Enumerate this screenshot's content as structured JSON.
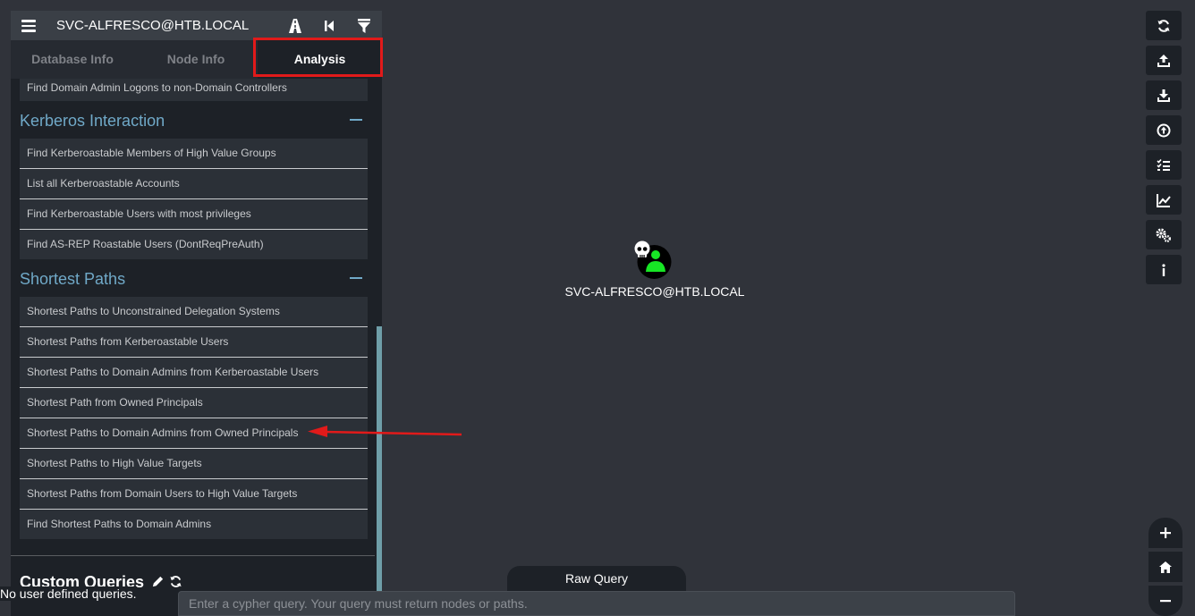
{
  "header": {
    "node_title": "SVC-ALFRESCO@HTB.LOCAL"
  },
  "tabs": [
    {
      "label": "Database Info"
    },
    {
      "label": "Node Info"
    },
    {
      "label": "Analysis"
    }
  ],
  "partial_query": "Find Domain Admin Logons to non-Domain Controllers",
  "sections": [
    {
      "title": "Kerberos Interaction",
      "queries": [
        "Find Kerberoastable Members of High Value Groups",
        "List all Kerberoastable Accounts",
        "Find Kerberoastable Users with most privileges",
        "Find AS-REP Roastable Users (DontReqPreAuth)"
      ]
    },
    {
      "title": "Shortest Paths",
      "queries": [
        "Shortest Paths to Unconstrained Delegation Systems",
        "Shortest Paths from Kerberoastable Users",
        "Shortest Paths to Domain Admins from Kerberoastable Users",
        "Shortest Path from Owned Principals",
        "Shortest Paths to Domain Admins from Owned Principals",
        "Shortest Paths to High Value Targets",
        "Shortest Paths from Domain Users to High Value Targets",
        "Find Shortest Paths to Domain Admins"
      ]
    }
  ],
  "custom_queries": {
    "title": "Custom Queries",
    "empty_text": "No user defined queries."
  },
  "graph_node": {
    "label": "SVC-ALFRESCO@HTB.LOCAL",
    "owned": true
  },
  "toolbar": [
    "refresh-icon",
    "export-icon",
    "import-icon",
    "upload-icon",
    "queries-list-icon",
    "chart-icon",
    "settings-icon",
    "info-icon"
  ],
  "zoom": [
    "zoom-in-icon",
    "home-icon",
    "zoom-out-icon"
  ],
  "raw_query": {
    "tab_label": "Raw Query",
    "placeholder": "Enter a cypher query. Your query must return nodes or paths."
  },
  "colors": {
    "accent": "#70a9c8",
    "annotation": "#e11a1a",
    "owned_user": "#17e625"
  }
}
